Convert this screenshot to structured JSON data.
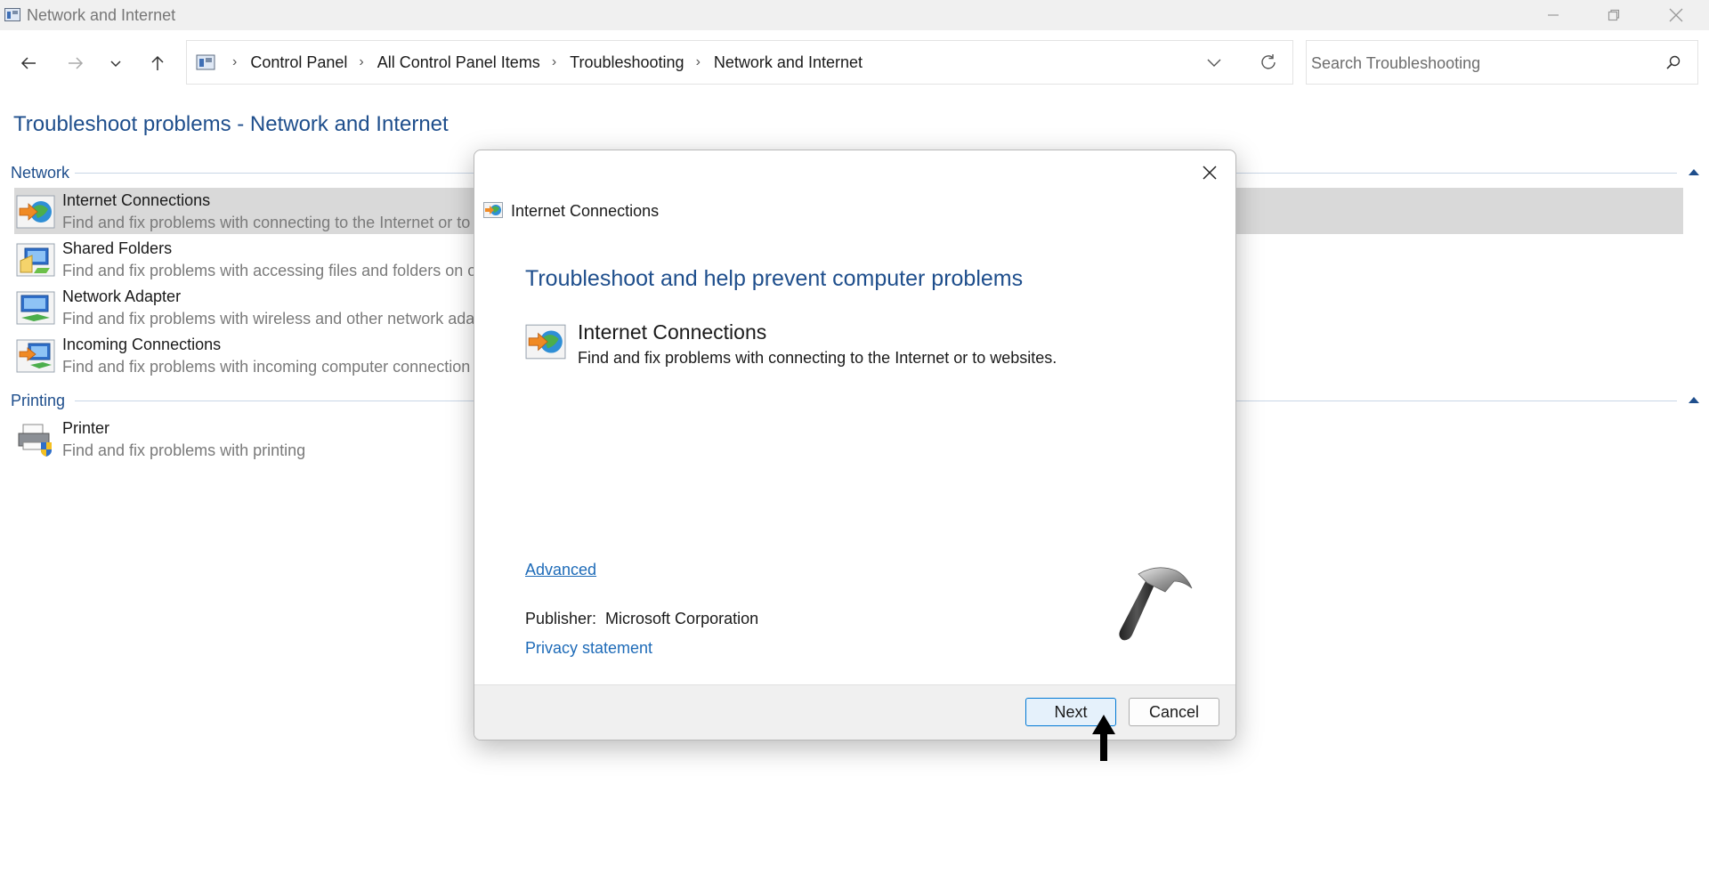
{
  "window": {
    "title": "Network and Internet",
    "controls": [
      "minimize-icon",
      "restore-icon",
      "close-icon"
    ]
  },
  "address": {
    "breadcrumb": [
      "Control Panel",
      "All Control Panel Items",
      "Troubleshooting",
      "Network and Internet"
    ],
    "search_placeholder": "Search Troubleshooting"
  },
  "page": {
    "title": "Troubleshoot problems - Network and Internet",
    "groups": [
      {
        "name": "Network",
        "items": [
          {
            "name": "Internet Connections",
            "desc": "Find and fix problems with connecting to the Internet or to",
            "icon": "internet-connections-icon",
            "selected": true
          },
          {
            "name": "Shared Folders",
            "desc": "Find and fix problems with accessing files and folders on o",
            "icon": "shared-folders-icon"
          },
          {
            "name": "Network Adapter",
            "desc": "Find and fix problems with wireless and other network ada",
            "icon": "network-adapter-icon"
          },
          {
            "name": "Incoming Connections",
            "desc": "Find and fix problems with incoming computer connection",
            "icon": "incoming-connections-icon"
          }
        ]
      },
      {
        "name": "Printing",
        "items": [
          {
            "name": "Printer",
            "desc": "Find and fix problems with printing",
            "icon": "printer-icon"
          }
        ]
      }
    ]
  },
  "dialog": {
    "title": "Internet Connections",
    "heading": "Troubleshoot and help prevent computer problems",
    "tool_name": "Internet Connections",
    "tool_desc": "Find and fix problems with connecting to the Internet or to websites.",
    "advanced_link": "Advanced",
    "publisher_label": "Publisher:",
    "publisher_value": "Microsoft Corporation",
    "privacy_link": "Privacy statement",
    "next_label": "Next",
    "cancel_label": "Cancel"
  },
  "colors": {
    "accent_blue": "#1e4e8c",
    "link_blue": "#1e6bb8",
    "selected_row": "#d9d9d9"
  }
}
